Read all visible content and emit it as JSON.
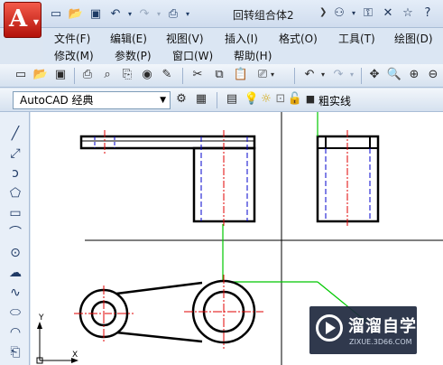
{
  "window": {
    "title": "回转组合体2",
    "app_letter": "A",
    "colors": {
      "app_button": "#c8160d",
      "canvas": "#ffffff",
      "accent_line": "#00c800"
    }
  },
  "quick_access": {
    "icons": [
      "new-icon",
      "open-icon",
      "save-icon",
      "undo-icon",
      "redo-icon",
      "print-icon"
    ],
    "title_icons": [
      "binoculars-icon",
      "key-icon",
      "star-icon",
      "help-icon"
    ]
  },
  "menu": {
    "file": "文件(F)",
    "edit": "编辑(E)",
    "view": "视图(V)",
    "insert": "插入(I)",
    "format": "格式(O)",
    "tools": "工具(T)",
    "draw": "绘图(D)",
    "modify": "修改(M)",
    "parameters": "参数(P)",
    "window": "窗口(W)",
    "help": "帮助(H)"
  },
  "workspace": {
    "selected": "AutoCAD 经典"
  },
  "layer": {
    "current": "粗实线"
  },
  "ucs": {
    "y_label": "Y",
    "x_label": "X"
  },
  "watermark": {
    "main": "溜溜自学",
    "sub": "ZIXUE.3D66.COM"
  }
}
